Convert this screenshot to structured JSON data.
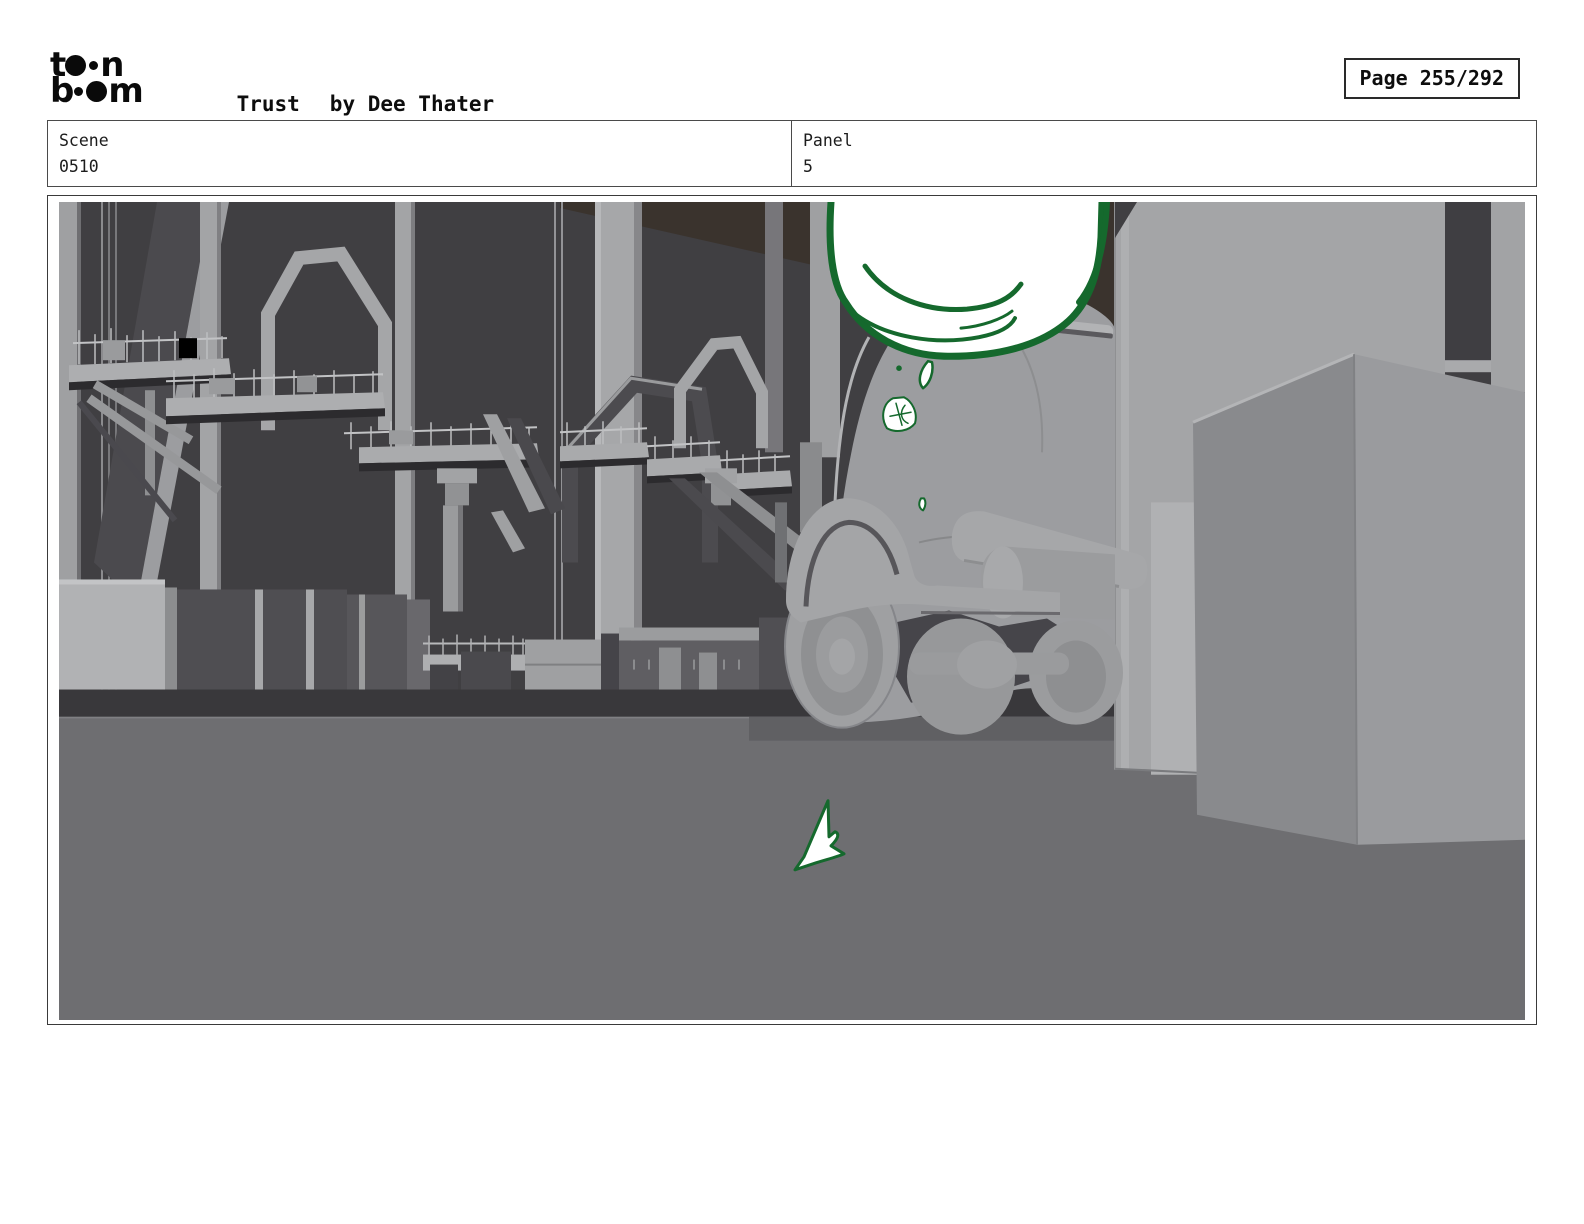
{
  "header": {
    "logo": {
      "alt": "toon boom",
      "line1_start": "t",
      "line1_end": "n",
      "line2_start": "b",
      "line2_end": "m"
    },
    "title": "Trust",
    "author": "by Dee Thater",
    "page_indicator": "Page 255/292"
  },
  "meta": {
    "scene": {
      "label": "Scene",
      "value": "0510"
    },
    "panel": {
      "label": "Panel",
      "value": "5"
    }
  },
  "panel_image": {
    "description": "Gray 3D layout render of a container port: gantry cranes and stacked containers in the background, low-angle truck with wheels in the foreground, large cargo box at right, annotated with dark-green and white sketch marks (balloon shape at top, check-like mark on the ground)",
    "annotation_color": "#15692d"
  }
}
